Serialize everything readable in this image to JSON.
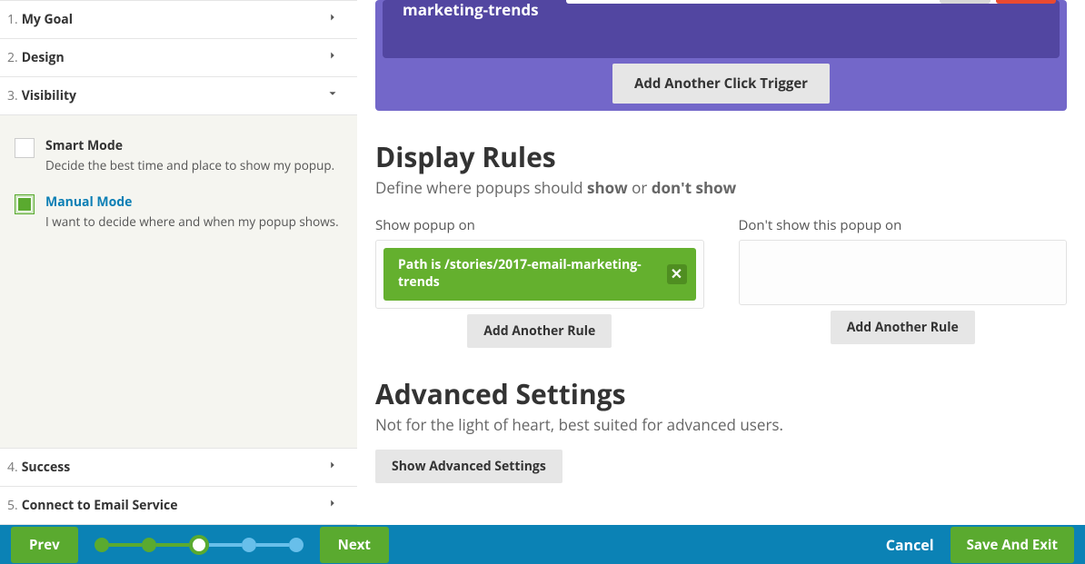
{
  "sidebar": {
    "steps": {
      "s1": {
        "num": "1.",
        "label": "My Goal"
      },
      "s2": {
        "num": "2.",
        "label": "Design"
      },
      "s3": {
        "num": "3.",
        "label": "Visibility"
      },
      "s4": {
        "num": "4.",
        "label": "Success"
      },
      "s5": {
        "num": "5.",
        "label": "Connect to Email Service"
      }
    },
    "smart": {
      "title": "Smart Mode",
      "desc": "Decide the best time and place to show my popup."
    },
    "manual": {
      "title": "Manual Mode",
      "desc": "I want to decide where and when my popup shows."
    }
  },
  "main": {
    "trigger_caption": "marketing-trends",
    "add_trigger": "Add Another Click Trigger",
    "display_rules": {
      "heading": "Display Rules",
      "sub_pre": "Define where popups should ",
      "sub_b1": "show",
      "sub_mid": " or ",
      "sub_b2": "don't show"
    },
    "rules": {
      "show_label": "Show popup on",
      "show_chip": "Path is /stories/2017-email-marketing-trends",
      "hide_label": "Don't show this popup on",
      "add_rule": "Add Another Rule"
    },
    "advanced": {
      "heading": "Advanced Settings",
      "sub": "Not for the light of heart, best suited for advanced users.",
      "btn": "Show Advanced Settings"
    }
  },
  "footer": {
    "prev": "Prev",
    "next": "Next",
    "cancel": "Cancel",
    "save": "Save And Exit"
  }
}
